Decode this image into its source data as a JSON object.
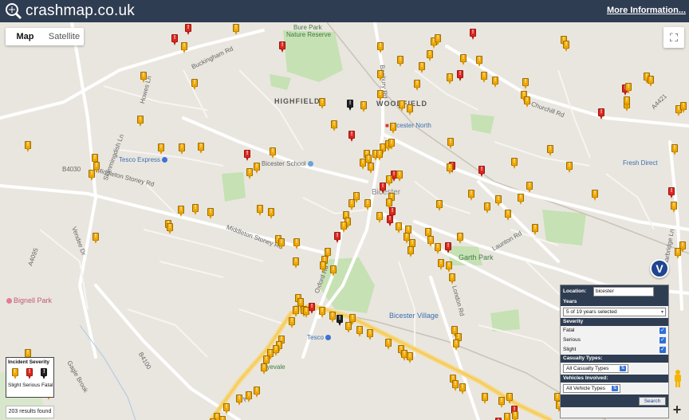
{
  "header": {
    "site_title": "crashmap.co.uk",
    "more_info": "More Information..."
  },
  "map_controls": {
    "map_label": "Map",
    "satellite_label": "Satellite",
    "fullscreen_icon": "fullscreen-icon"
  },
  "map_labels": {
    "highfield": "HIGHFIELD",
    "woodfield": "WOODFIELD",
    "bure_park": "Bure Park",
    "nature_reserve": "Nature Reserve",
    "bicester_north": "Bicester North",
    "bicester_school": "Bicester School",
    "bicester": "Bicester",
    "tesco_express": "Tesco Express",
    "fresh_direct": "Fresh Direct",
    "garth_park": "Garth Park",
    "bignell_park": "Bignell Park",
    "bicester_village": "Bicester Village",
    "tesco": "Tesco",
    "wyevale": "Wyevale",
    "middleton_stoney_rd": "Middleton Stoney Rd",
    "middleton_stoney_rd_2": "Middleton Stoney Rd",
    "b4030": "B4030",
    "a4095": "A4095",
    "b4100": "B4100",
    "a41": "A41",
    "a4421": "A4421",
    "churchill_rd": "Churchill Rd",
    "launton_rd": "Launton Rd",
    "london_rd": "London Rd",
    "vendee_dr": "Vendee Dr",
    "gagle_brook": "Gagle Brook",
    "oxford_rd": "Oxford Rd",
    "banbury_rd": "Banbury Rd",
    "charbridge_ln": "Charbridge Ln",
    "buckingham_rd": "Buckingham Rd",
    "howes_ln": "Howes Ln",
    "skimmingdish_ln": "Skimmingdish Ln"
  },
  "legend": {
    "title": "Incident Severity",
    "slight": "Slight",
    "serious": "Serious",
    "fatal": "Fatal",
    "colors": {
      "slight": "#f0a800",
      "serious": "#e0261e",
      "fatal": "#222222"
    }
  },
  "results": "203 results found",
  "badge": "V",
  "panel": {
    "location_label": "Location:",
    "location_value": "bicester",
    "years_label": "Years",
    "years_value": "5 of 19 years selected",
    "severity_label": "Severity",
    "severity_options": [
      {
        "label": "Fatal",
        "checked": true
      },
      {
        "label": "Serious",
        "checked": true
      },
      {
        "label": "Slight",
        "checked": true
      }
    ],
    "casualty_label": "Casualty Types:",
    "casualty_value": "All Casualty Types",
    "vehicles_label": "Vehicles Involved:",
    "vehicles_value": "All Vehicle Types",
    "search_label": "Search"
  },
  "zoom_in": "+"
}
